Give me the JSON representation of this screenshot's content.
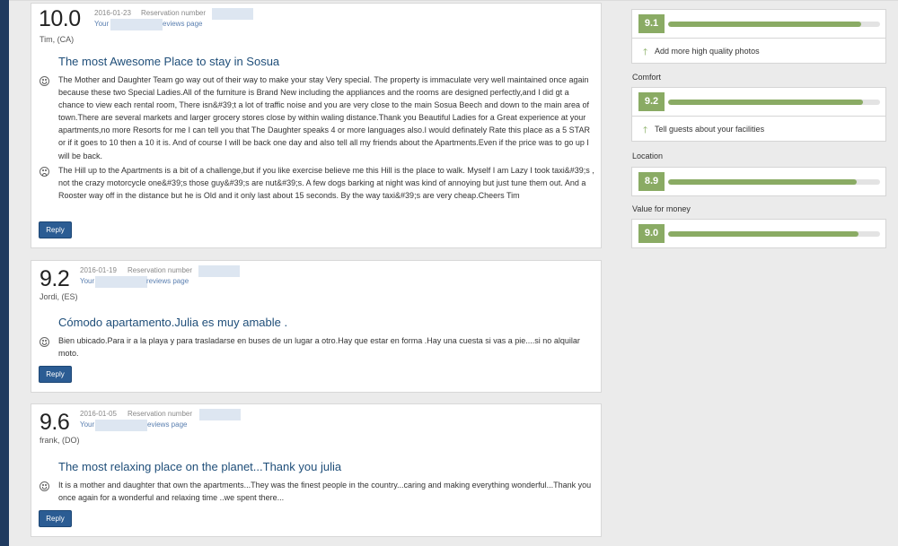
{
  "reviews": [
    {
      "score": "10.0",
      "date": "2016-01-23",
      "reservation_label": "Reservation number",
      "your_label": "Your",
      "reviews_page_label": "eviews page",
      "author": "Tim, (CA)",
      "title": "The most Awesome Place to stay in Sosua",
      "positive": "The Mother and Daughter Team go way out of their way to make your stay Very special. The property is immaculate very well maintained once again because these two Special Ladies.All of the furniture is Brand New including the appliances and the rooms are designed perfectly,and I did gt a chance to view each rental room, There isn&#39;t a lot of traffic noise and you are very close to the main Sosua Beech and down to the main area of town.There are several markets and larger grocery stores close by within waling distance.Thank you Beautiful Ladies for a Great experience at your apartments,no more Resorts for me I can tell you that The Daughter speaks 4 or more languages also.I would definately Rate this place as a 5 STAR or if it goes to 10 then a 10 it is. And of course I will be back one day and also tell all my friends about the Apartments.Even if the price was to go up I will be back.",
      "negative": "The Hill up to the Apartments is a bit of a challenge,but if you like exercise believe me this Hill is the place to walk. Myself I am Lazy I took taxi&#39;s , not the crazy motorcycle one&#39;s those guy&#39;s are nut&#39;s. A few dogs barking at night was kind of annoying but just tune them out. And a Rooster way off in the distance but he is Old and it only last about 15 seconds. By the way taxi&#39;s are very cheap.Cheers Tim",
      "reply_label": "Reply"
    },
    {
      "score": "9.2",
      "date": "2016-01-19",
      "reservation_label": "Reservation number",
      "your_label": "Your",
      "reviews_page_label": "reviews page",
      "author": "Jordi, (ES)",
      "title": "Cómodo apartamento.Julia es muy amable .",
      "positive": "Bien ubicado.Para ir a la playa y para trasladarse en buses de un lugar a otro.Hay que estar en forma .Hay una cuesta si vas a pie....si no alquilar moto.",
      "reply_label": "Reply"
    },
    {
      "score": "9.6",
      "date": "2016-01-05",
      "reservation_label": "Reservation number",
      "your_label": "Your",
      "reviews_page_label": "eviews page",
      "author": "frank, (DO)",
      "title": "The most relaxing place on the planet...Thank you julia",
      "positive": "It is a mother and daughter that own the apartments...They was the finest people in the country...caring and making everything wonderful...Thank you once again for a wonderful and relaxing time ..we spent there...",
      "reply_label": "Reply"
    }
  ],
  "sidebar": {
    "categories": [
      {
        "label": "",
        "score": "9.1",
        "level": 0.91,
        "tip": "Add more high quality photos"
      },
      {
        "label": "Comfort",
        "score": "9.2",
        "level": 0.92,
        "tip": "Tell guests about your facilities"
      },
      {
        "label": "Location",
        "score": "8.9",
        "level": 0.89
      },
      {
        "label": "Value for money",
        "score": "9.0",
        "level": 0.9
      }
    ]
  },
  "colors": {
    "score_green": "#8aab64",
    "reply_blue": "#2b5c93",
    "title_blue": "#1f4e79",
    "left_bar": "#1f3a5f"
  },
  "icons": {
    "positive": "smile-icon",
    "negative": "frown-icon",
    "tip": "arrow-up-icon"
  }
}
